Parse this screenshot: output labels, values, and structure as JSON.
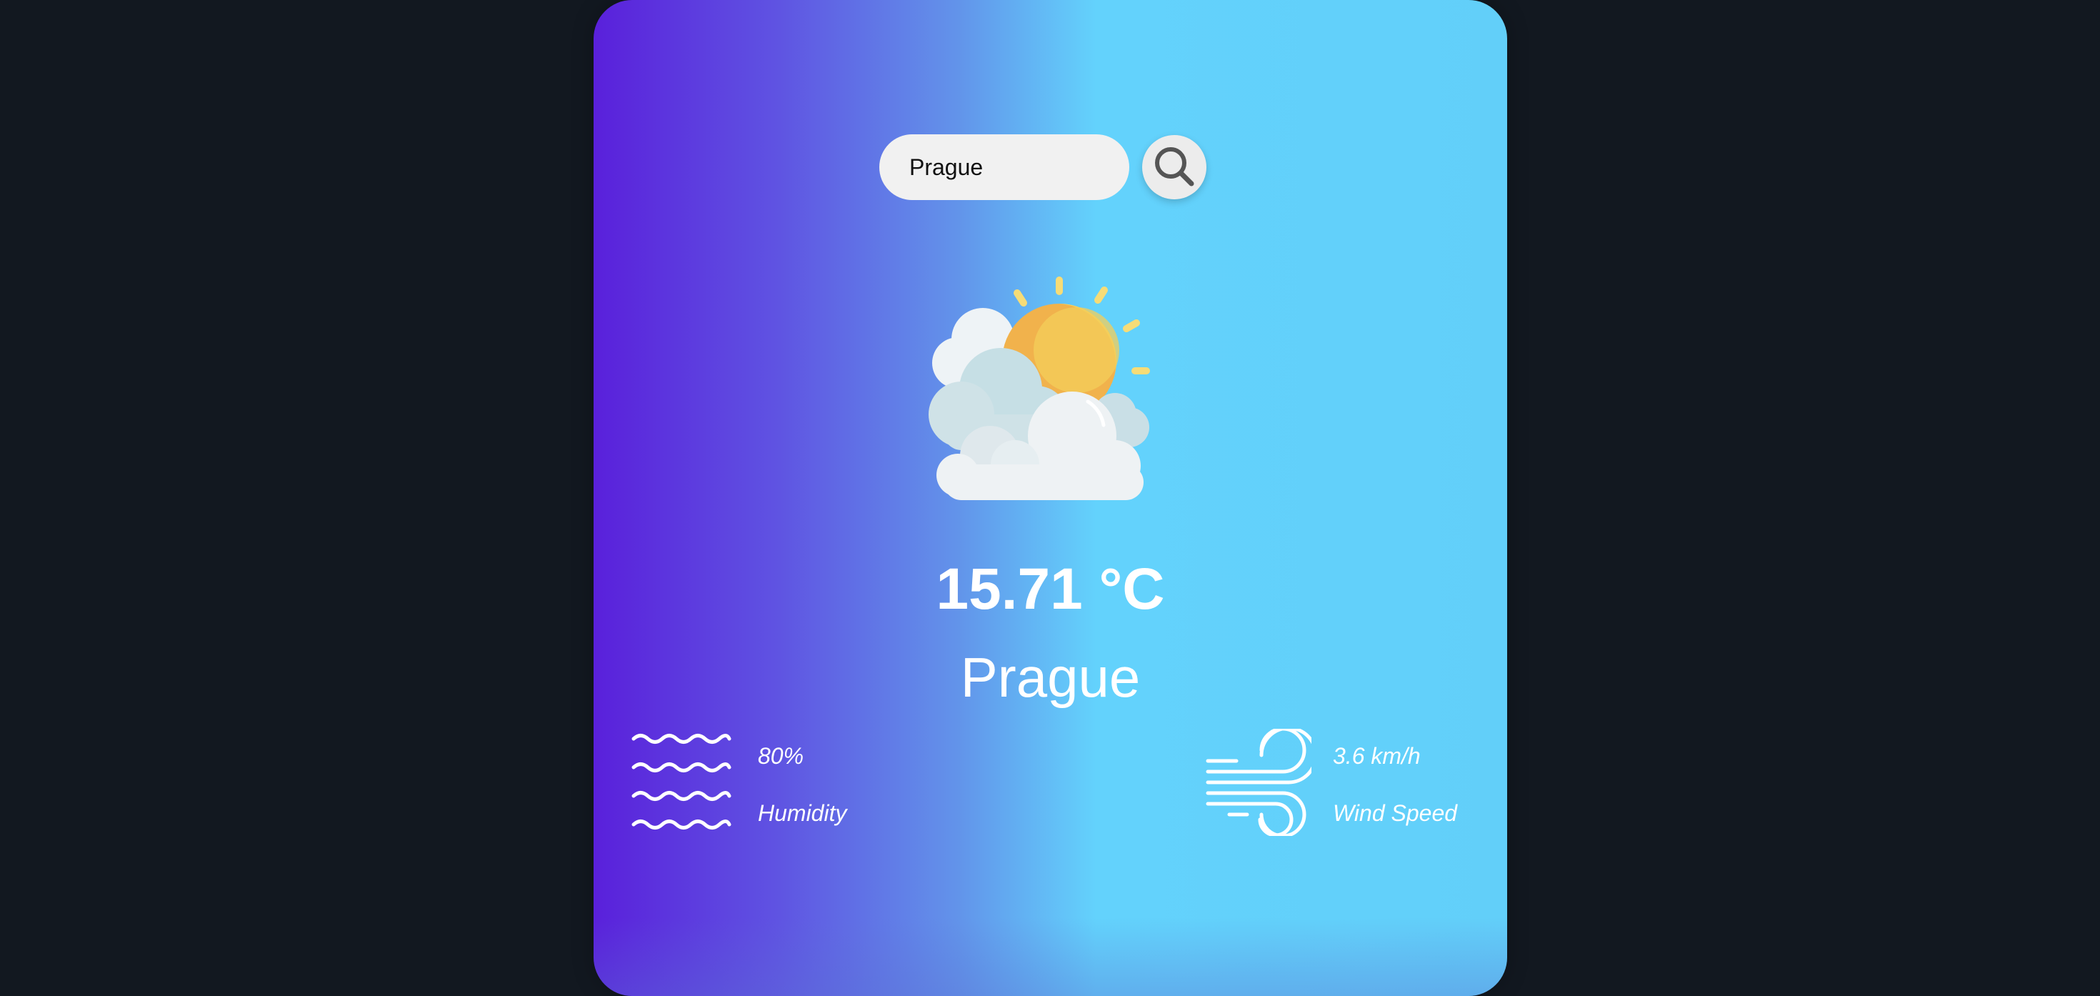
{
  "search": {
    "value": "Prague",
    "placeholder": ""
  },
  "weather": {
    "icon": "partly-cloudy-icon",
    "temperature": "15.71 °C",
    "city": "Prague"
  },
  "details": {
    "humidity": {
      "icon": "humidity-waves-icon",
      "value": "80%",
      "label": "Humidity"
    },
    "wind": {
      "icon": "wind-icon",
      "value": "3.6 km/h",
      "label": "Wind Speed"
    }
  },
  "colors": {
    "background": "#121820",
    "card_gradient_start": "#5a20db",
    "card_gradient_end": "#62cff9",
    "text": "#ffffff",
    "sun": "#f1b24c",
    "sun_highlight": "#f5d45e"
  }
}
